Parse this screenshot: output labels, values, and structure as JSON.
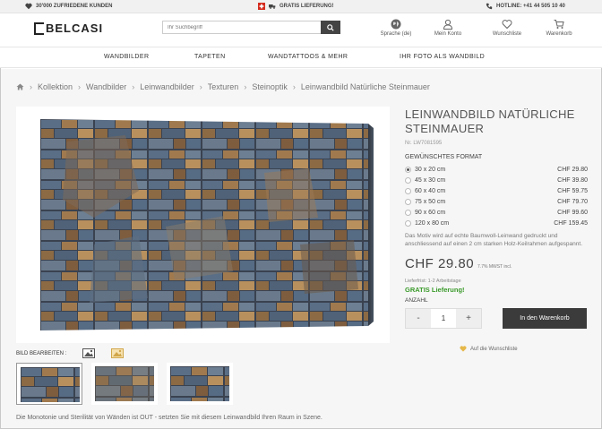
{
  "topbar": {
    "customers": "30'000 ZUFRIEDENE KUNDEN",
    "delivery": "GRATIS LIEFERUNG!",
    "hotline": "HOTLINE: +41 44 505 10 40"
  },
  "header": {
    "logo": "BELCASI",
    "search_placeholder": "Ihr Suchbegriff",
    "language": "Sprache (de)",
    "account": "Mein Konto",
    "wishlist": "Wunschliste",
    "cart": "Warenkorb"
  },
  "nav": [
    "WANDBILDER",
    "TAPETEN",
    "WANDTATTOOS & MEHR",
    "IHR FOTO ALS WANDBILD"
  ],
  "breadcrumb": [
    "Kollektion",
    "Wandbilder",
    "Leinwandbilder",
    "Texturen",
    "Steinoptik",
    "Leinwandbild Natürliche Steinmauer"
  ],
  "edit": {
    "label": "BILD BEARBEITEN :"
  },
  "description": "Die Monotonie und Sterilität von Wänden ist OUT - setzten Sie mit diesem Leinwandbild Ihren Raum in Szene.",
  "product": {
    "title": "LEINWANDBILD NATÜRLICHE STEINMAUER",
    "number": "Nr. LW7081595",
    "format_title": "GEWÜNSCHTES FORMAT",
    "formats": [
      {
        "size": "30 x 20 cm",
        "price": "CHF 29.80"
      },
      {
        "size": "45 x 30 cm",
        "price": "CHF 39.80"
      },
      {
        "size": "60 x 40 cm",
        "price": "CHF 59.75"
      },
      {
        "size": "75 x 50 cm",
        "price": "CHF 79.70"
      },
      {
        "size": "90 x 60 cm",
        "price": "CHF 99.60"
      },
      {
        "size": "120 x 80 cm",
        "price": "CHF 159.45"
      }
    ],
    "selected_format": "30 x 20 cm",
    "text": "Das Motiv wird auf echte Baumwoll-Leinwand gedruckt und anschliessend auf einen 2 cm starken Holz-Keilrahmen aufgespannt.",
    "price": "CHF 29.80",
    "vat": "7.7% MWST incl.",
    "delivery_time": "Lieferfrist: 1-2 Arbeitstage",
    "free_delivery": "GRATIS Lieferung!",
    "quantity_label": "ANZAHL",
    "quantity": "1",
    "minus": "-",
    "plus": "+",
    "cart_button": "In den Warenkorb",
    "wishlist_link": "Auf die Wunschliste"
  },
  "colors": {
    "accent_green": "#3a9a2a",
    "dark": "#3b3b3b",
    "heart": "#e6b84a"
  }
}
